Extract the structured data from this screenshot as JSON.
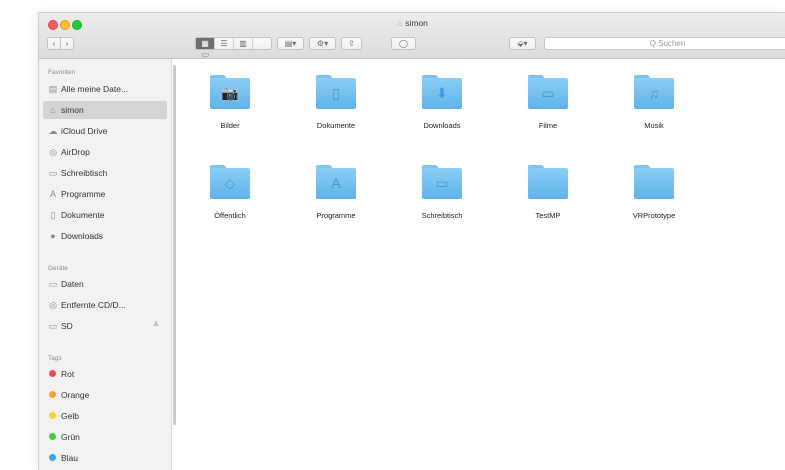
{
  "window": {
    "title": "simon",
    "title_icon": "home-icon"
  },
  "toolbar": {
    "back_label": "‹",
    "forward_label": "›",
    "view_modes": [
      "icon-view",
      "list-view",
      "column-view",
      "gallery-view"
    ],
    "arrange_label": "▤▾",
    "action_label": "⚙▾",
    "share_label": "⇪",
    "tag_label": "◯",
    "dropbox_label": "⬙▾",
    "search_placeholder": "Q Suchen"
  },
  "sidebar": {
    "favorites_heading": "Favoriten",
    "favorites": [
      {
        "label": "Alle meine Date...",
        "icon": "all-files-icon"
      },
      {
        "label": "simon",
        "icon": "home-icon",
        "selected": true
      },
      {
        "label": "iCloud Drive",
        "icon": "cloud-icon"
      },
      {
        "label": "AirDrop",
        "icon": "airdrop-icon"
      },
      {
        "label": "Schreibtisch",
        "icon": "desktop-icon"
      },
      {
        "label": "Programme",
        "icon": "applications-icon"
      },
      {
        "label": "Dokumente",
        "icon": "documents-icon"
      },
      {
        "label": "Downloads",
        "icon": "downloads-icon"
      }
    ],
    "devices_heading": "Geräte",
    "devices": [
      {
        "label": "Daten",
        "icon": "disk-icon"
      },
      {
        "label": "Entfernte CD/D...",
        "icon": "remote-disc-icon"
      },
      {
        "label": "SD",
        "icon": "sd-card-icon",
        "eject": "≜"
      }
    ],
    "tags_heading": "Tags",
    "tags": [
      {
        "label": "Rot",
        "color": "#f44a4a"
      },
      {
        "label": "Orange",
        "color": "#f8a02c"
      },
      {
        "label": "Gelb",
        "color": "#f9d42e"
      },
      {
        "label": "Grün",
        "color": "#3fcb4a"
      },
      {
        "label": "Blau",
        "color": "#3aa5ef"
      }
    ]
  },
  "folders": [
    {
      "label": "Bilder",
      "glyph": "📷"
    },
    {
      "label": "Dokumente",
      "glyph": "▯"
    },
    {
      "label": "Downloads",
      "glyph": "⬇"
    },
    {
      "label": "Filme",
      "glyph": "▭"
    },
    {
      "label": "Musik",
      "glyph": "♫"
    },
    {
      "label": "Öffentlich",
      "glyph": "◇"
    },
    {
      "label": "Programme",
      "glyph": "A"
    },
    {
      "label": "Schreibtisch",
      "glyph": "▭"
    },
    {
      "label": "TestMP",
      "glyph": ""
    },
    {
      "label": "VRPrototype",
      "glyph": ""
    }
  ]
}
